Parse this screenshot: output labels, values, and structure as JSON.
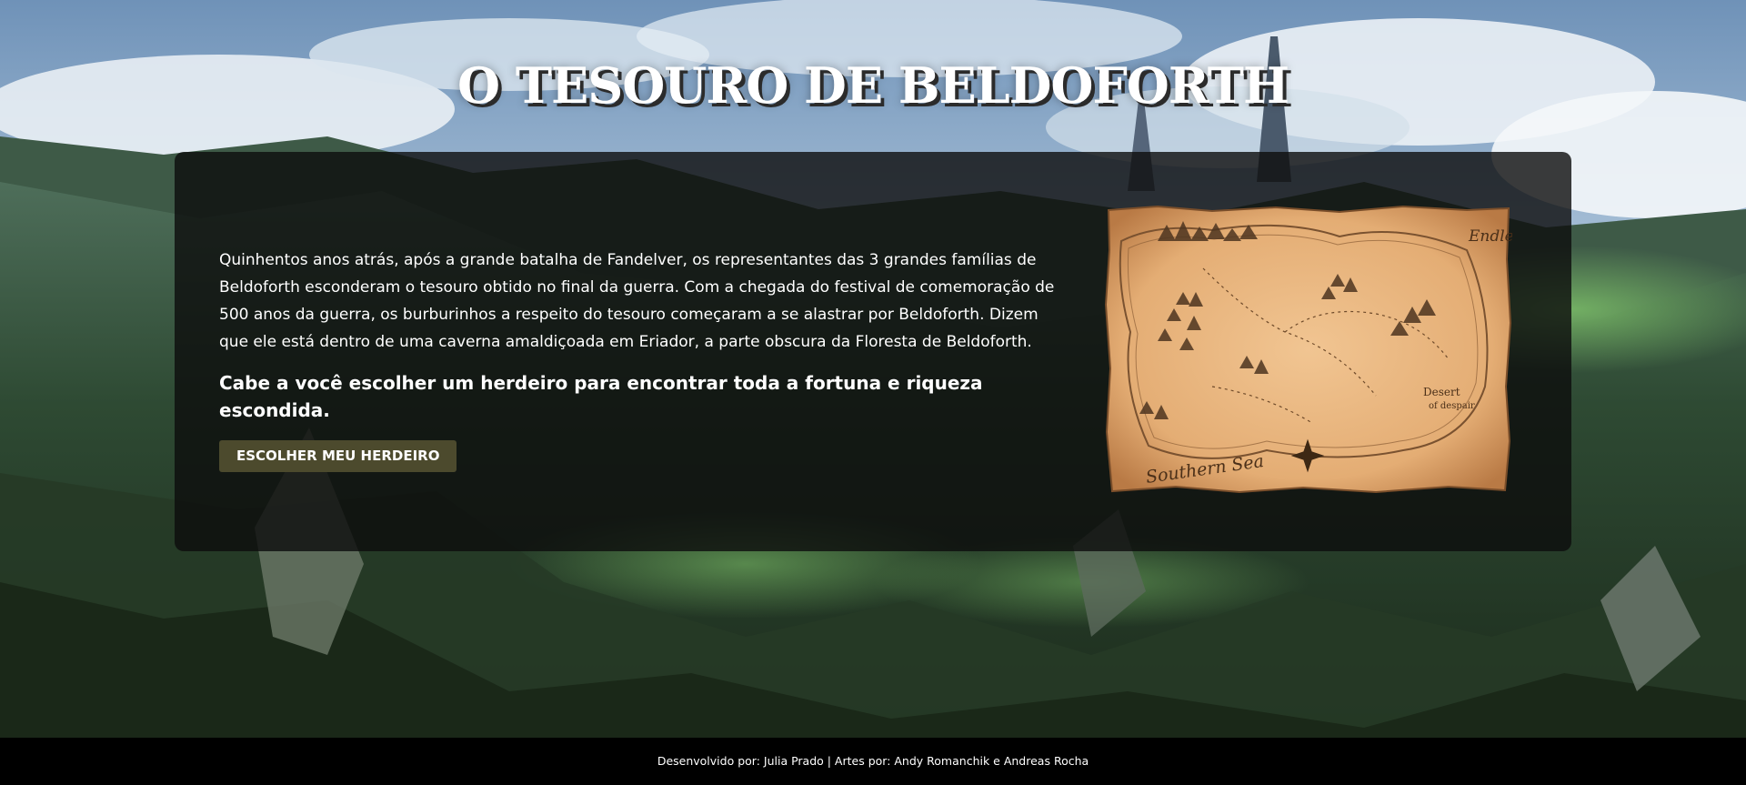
{
  "page": {
    "title": "O TESOURO DE BELDOFORTH"
  },
  "content": {
    "intro": "Quinhentos anos atrás, após a grande batalha de Fandelver, os representantes das 3 grandes famílias de Beldoforth esconderam o tesouro obtido no final da guerra. Com a chegada do festival de comemoração de 500 anos da guerra, os burburinhos a respeito do tesouro começaram a se alastrar por Beldoforth. Dizem que ele está dentro de uma caverna amaldiçoada em Eriador, a parte obscura da Floresta de Beldoforth.",
    "highlight": "Cabe a você escolher um herdeiro para encontrar toda a fortuna e riqueza escondida.",
    "cta_label": "ESCOLHER MEU HERDEIRO"
  },
  "map": {
    "labels": {
      "top_right": "Endless",
      "right": "Desert",
      "right_sub": "of despair",
      "bottom": "Southern Sea"
    }
  },
  "footer": {
    "credits": "Desenvolvido por: Julia Prado | Artes por: Andy Romanchik e Andreas Rocha"
  },
  "colors": {
    "card_bg": "#0c0c0c",
    "button_bg": "#4c4a2d",
    "footer_bg": "#000000",
    "parchment": "#e9b681"
  }
}
